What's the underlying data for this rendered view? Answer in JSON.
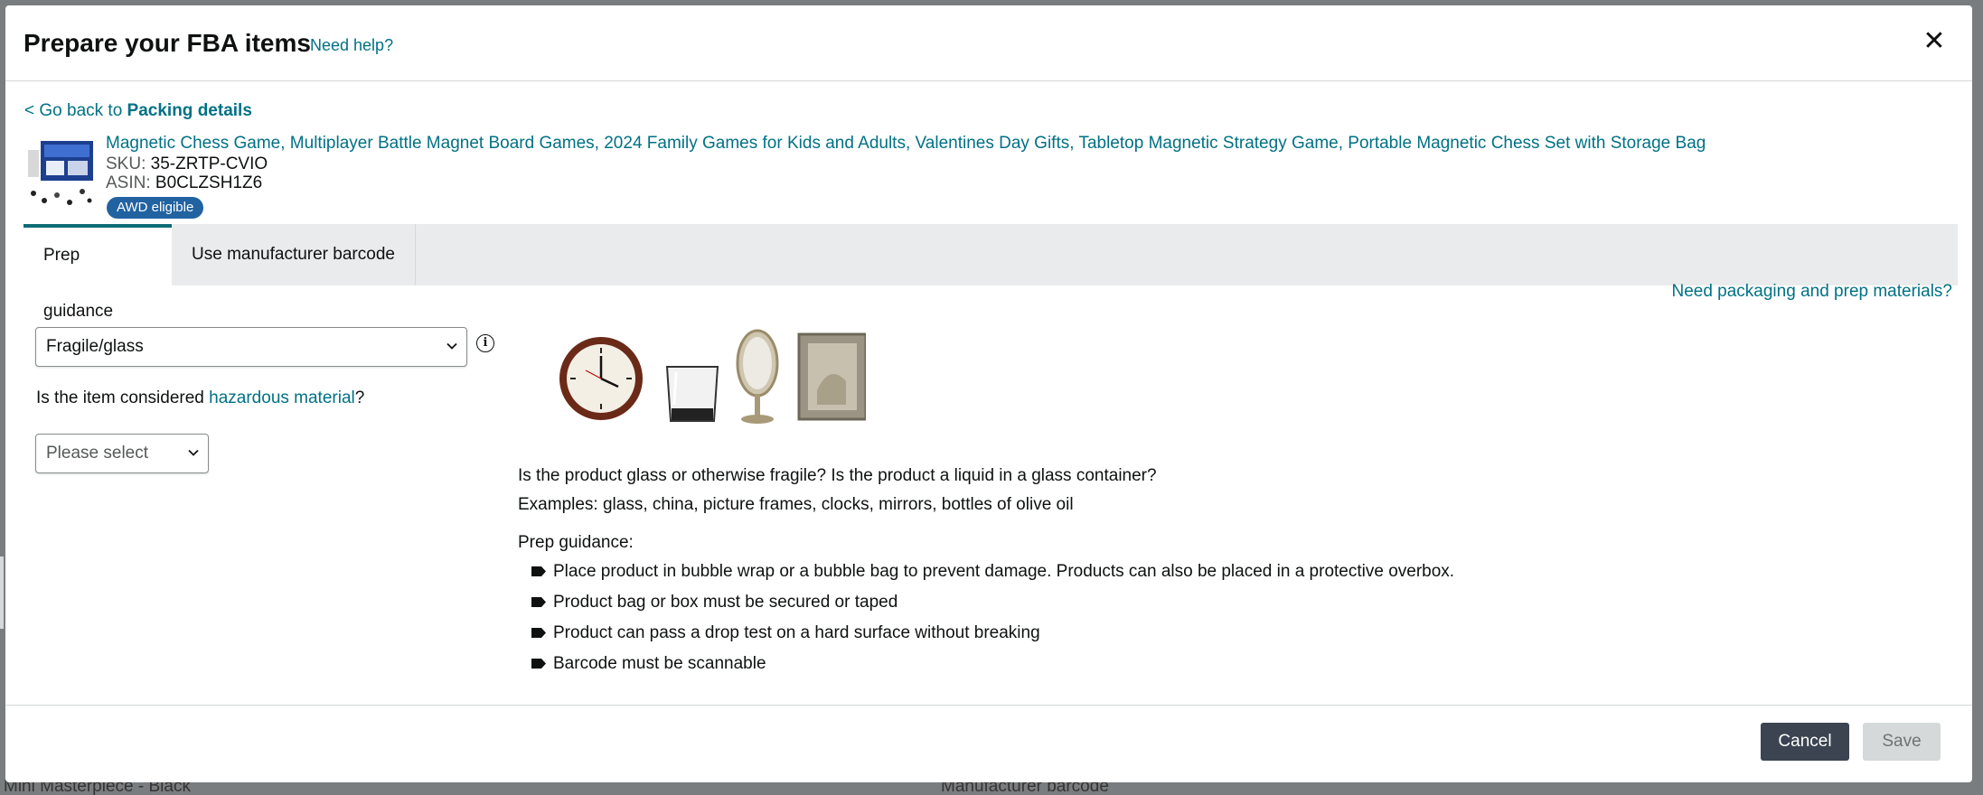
{
  "background": {
    "left_text": "Mini Masterpiece - Black",
    "mid_text": "Manufacturer barcode"
  },
  "modal": {
    "title": "Prepare your FBA items",
    "help_link": "Need help?",
    "close_icon": "close-icon"
  },
  "back": {
    "prefix": "< Go back to ",
    "target": "Packing details"
  },
  "product": {
    "title": "Magnetic Chess Game, Multiplayer Battle Magnet Board Games, 2024 Family Games for Kids and Adults, Valentines Day Gifts, Tabletop Magnetic Strategy Game, Portable Magnetic Chess Set with Storage Bag",
    "sku_label": "SKU:",
    "sku": "35-ZRTP-CVIO",
    "asin_label": "ASIN:",
    "asin": "B0CLZSH1Z6",
    "badge": "AWD eligible"
  },
  "tabs": [
    {
      "label": "Prep guidance",
      "active": true
    },
    {
      "label": "Use manufacturer barcode",
      "active": false
    }
  ],
  "packaging_link": "Need packaging and prep materials?",
  "prep_category": {
    "selected": "Fragile/glass"
  },
  "hazmat": {
    "question_prefix": "Is the item considered ",
    "question_link": "hazardous material",
    "question_suffix": "?",
    "selected": "Please select"
  },
  "guidance": {
    "line1": "Is the product glass or otherwise fragile? Is the product a liquid in a glass container?",
    "line2": "Examples: glass, china, picture frames, clocks, mirrors, bottles of olive oil",
    "heading": "Prep guidance:",
    "bullets": [
      "Place product in bubble wrap or a bubble bag to prevent damage. Products can also be placed in a protective overbox.",
      "Product bag or box must be secured or taped",
      "Product can pass a drop test on a hard surface without breaking",
      "Barcode must be scannable"
    ]
  },
  "footer": {
    "cancel": "Cancel",
    "save": "Save"
  },
  "colors": {
    "link": "#007185",
    "badge": "#2162a1",
    "cancel_bg": "#3b4450",
    "save_bg": "#d5d9d9"
  }
}
